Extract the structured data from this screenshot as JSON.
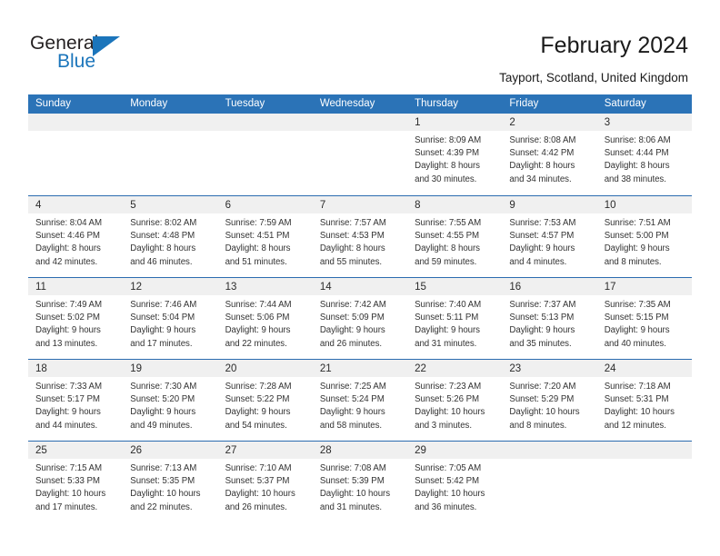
{
  "brand": {
    "word_one": "General",
    "word_two": "Blue",
    "primary_color": "#1b75bb",
    "triangle_icon": "triangle-right-icon"
  },
  "header": {
    "title": "February 2024",
    "location": "Tayport, Scotland, United Kingdom"
  },
  "calendar": {
    "header_color": "#2b73b7",
    "weekday_headers": [
      "Sunday",
      "Monday",
      "Tuesday",
      "Wednesday",
      "Thursday",
      "Friday",
      "Saturday"
    ],
    "weeks": [
      [
        {
          "day": "",
          "lines": []
        },
        {
          "day": "",
          "lines": []
        },
        {
          "day": "",
          "lines": []
        },
        {
          "day": "",
          "lines": []
        },
        {
          "day": "1",
          "lines": [
            "Sunrise: 8:09 AM",
            "Sunset: 4:39 PM",
            "Daylight: 8 hours",
            "and 30 minutes."
          ]
        },
        {
          "day": "2",
          "lines": [
            "Sunrise: 8:08 AM",
            "Sunset: 4:42 PM",
            "Daylight: 8 hours",
            "and 34 minutes."
          ]
        },
        {
          "day": "3",
          "lines": [
            "Sunrise: 8:06 AM",
            "Sunset: 4:44 PM",
            "Daylight: 8 hours",
            "and 38 minutes."
          ]
        }
      ],
      [
        {
          "day": "4",
          "lines": [
            "Sunrise: 8:04 AM",
            "Sunset: 4:46 PM",
            "Daylight: 8 hours",
            "and 42 minutes."
          ]
        },
        {
          "day": "5",
          "lines": [
            "Sunrise: 8:02 AM",
            "Sunset: 4:48 PM",
            "Daylight: 8 hours",
            "and 46 minutes."
          ]
        },
        {
          "day": "6",
          "lines": [
            "Sunrise: 7:59 AM",
            "Sunset: 4:51 PM",
            "Daylight: 8 hours",
            "and 51 minutes."
          ]
        },
        {
          "day": "7",
          "lines": [
            "Sunrise: 7:57 AM",
            "Sunset: 4:53 PM",
            "Daylight: 8 hours",
            "and 55 minutes."
          ]
        },
        {
          "day": "8",
          "lines": [
            "Sunrise: 7:55 AM",
            "Sunset: 4:55 PM",
            "Daylight: 8 hours",
            "and 59 minutes."
          ]
        },
        {
          "day": "9",
          "lines": [
            "Sunrise: 7:53 AM",
            "Sunset: 4:57 PM",
            "Daylight: 9 hours",
            "and 4 minutes."
          ]
        },
        {
          "day": "10",
          "lines": [
            "Sunrise: 7:51 AM",
            "Sunset: 5:00 PM",
            "Daylight: 9 hours",
            "and 8 minutes."
          ]
        }
      ],
      [
        {
          "day": "11",
          "lines": [
            "Sunrise: 7:49 AM",
            "Sunset: 5:02 PM",
            "Daylight: 9 hours",
            "and 13 minutes."
          ]
        },
        {
          "day": "12",
          "lines": [
            "Sunrise: 7:46 AM",
            "Sunset: 5:04 PM",
            "Daylight: 9 hours",
            "and 17 minutes."
          ]
        },
        {
          "day": "13",
          "lines": [
            "Sunrise: 7:44 AM",
            "Sunset: 5:06 PM",
            "Daylight: 9 hours",
            "and 22 minutes."
          ]
        },
        {
          "day": "14",
          "lines": [
            "Sunrise: 7:42 AM",
            "Sunset: 5:09 PM",
            "Daylight: 9 hours",
            "and 26 minutes."
          ]
        },
        {
          "day": "15",
          "lines": [
            "Sunrise: 7:40 AM",
            "Sunset: 5:11 PM",
            "Daylight: 9 hours",
            "and 31 minutes."
          ]
        },
        {
          "day": "16",
          "lines": [
            "Sunrise: 7:37 AM",
            "Sunset: 5:13 PM",
            "Daylight: 9 hours",
            "and 35 minutes."
          ]
        },
        {
          "day": "17",
          "lines": [
            "Sunrise: 7:35 AM",
            "Sunset: 5:15 PM",
            "Daylight: 9 hours",
            "and 40 minutes."
          ]
        }
      ],
      [
        {
          "day": "18",
          "lines": [
            "Sunrise: 7:33 AM",
            "Sunset: 5:17 PM",
            "Daylight: 9 hours",
            "and 44 minutes."
          ]
        },
        {
          "day": "19",
          "lines": [
            "Sunrise: 7:30 AM",
            "Sunset: 5:20 PM",
            "Daylight: 9 hours",
            "and 49 minutes."
          ]
        },
        {
          "day": "20",
          "lines": [
            "Sunrise: 7:28 AM",
            "Sunset: 5:22 PM",
            "Daylight: 9 hours",
            "and 54 minutes."
          ]
        },
        {
          "day": "21",
          "lines": [
            "Sunrise: 7:25 AM",
            "Sunset: 5:24 PM",
            "Daylight: 9 hours",
            "and 58 minutes."
          ]
        },
        {
          "day": "22",
          "lines": [
            "Sunrise: 7:23 AM",
            "Sunset: 5:26 PM",
            "Daylight: 10 hours",
            "and 3 minutes."
          ]
        },
        {
          "day": "23",
          "lines": [
            "Sunrise: 7:20 AM",
            "Sunset: 5:29 PM",
            "Daylight: 10 hours",
            "and 8 minutes."
          ]
        },
        {
          "day": "24",
          "lines": [
            "Sunrise: 7:18 AM",
            "Sunset: 5:31 PM",
            "Daylight: 10 hours",
            "and 12 minutes."
          ]
        }
      ],
      [
        {
          "day": "25",
          "lines": [
            "Sunrise: 7:15 AM",
            "Sunset: 5:33 PM",
            "Daylight: 10 hours",
            "and 17 minutes."
          ]
        },
        {
          "day": "26",
          "lines": [
            "Sunrise: 7:13 AM",
            "Sunset: 5:35 PM",
            "Daylight: 10 hours",
            "and 22 minutes."
          ]
        },
        {
          "day": "27",
          "lines": [
            "Sunrise: 7:10 AM",
            "Sunset: 5:37 PM",
            "Daylight: 10 hours",
            "and 26 minutes."
          ]
        },
        {
          "day": "28",
          "lines": [
            "Sunrise: 7:08 AM",
            "Sunset: 5:39 PM",
            "Daylight: 10 hours",
            "and 31 minutes."
          ]
        },
        {
          "day": "29",
          "lines": [
            "Sunrise: 7:05 AM",
            "Sunset: 5:42 PM",
            "Daylight: 10 hours",
            "and 36 minutes."
          ]
        },
        {
          "day": "",
          "lines": []
        },
        {
          "day": "",
          "lines": []
        }
      ]
    ]
  }
}
